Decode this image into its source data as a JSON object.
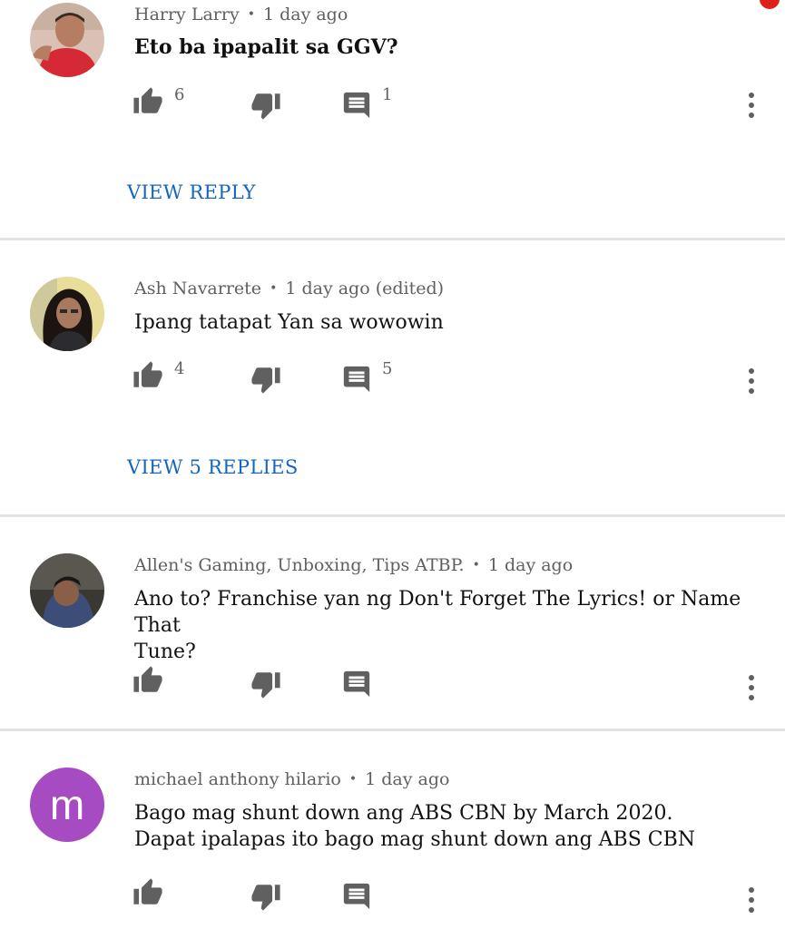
{
  "comments": [
    {
      "author": "Harry Larry",
      "time": "1 day ago",
      "text": "Eto ba ipapalit sa GGV?",
      "likes": "6",
      "replies_count": "1",
      "view_replies": "VIEW REPLY",
      "avatar": "photo"
    },
    {
      "author": "Ash Navarrete",
      "time": "1 day ago (edited)",
      "text": "Ipang tatapat Yan sa wowowin",
      "likes": "4",
      "replies_count": "5",
      "view_replies": "VIEW 5 REPLIES",
      "avatar": "photo"
    },
    {
      "author": "Allen's Gaming, Unboxing, Tips ATBP.",
      "time": "1 day ago",
      "text_line1": "Ano to? Franchise yan ng Don't Forget The Lyrics! or Name That",
      "text_line2": "Tune?",
      "avatar": "photo"
    },
    {
      "author": "michael anthony hilario",
      "time": "1 day ago",
      "text_line1": "Bago mag shunt down ang ABS CBN by March 2020.",
      "text_line2": "Dapat ipalapas ito bago mag shunt down ang ABS CBN",
      "avatar_letter": "m",
      "avatar_color": "#a64bc2"
    }
  ],
  "icons": {
    "like": "thumbs-up-icon",
    "dislike": "thumbs-down-icon",
    "reply": "comment-icon",
    "more": "more-vert-icon"
  },
  "colors": {
    "link": "#1565c0",
    "meta": "#606060",
    "icon": "#606060",
    "notification": "#e0201b"
  }
}
